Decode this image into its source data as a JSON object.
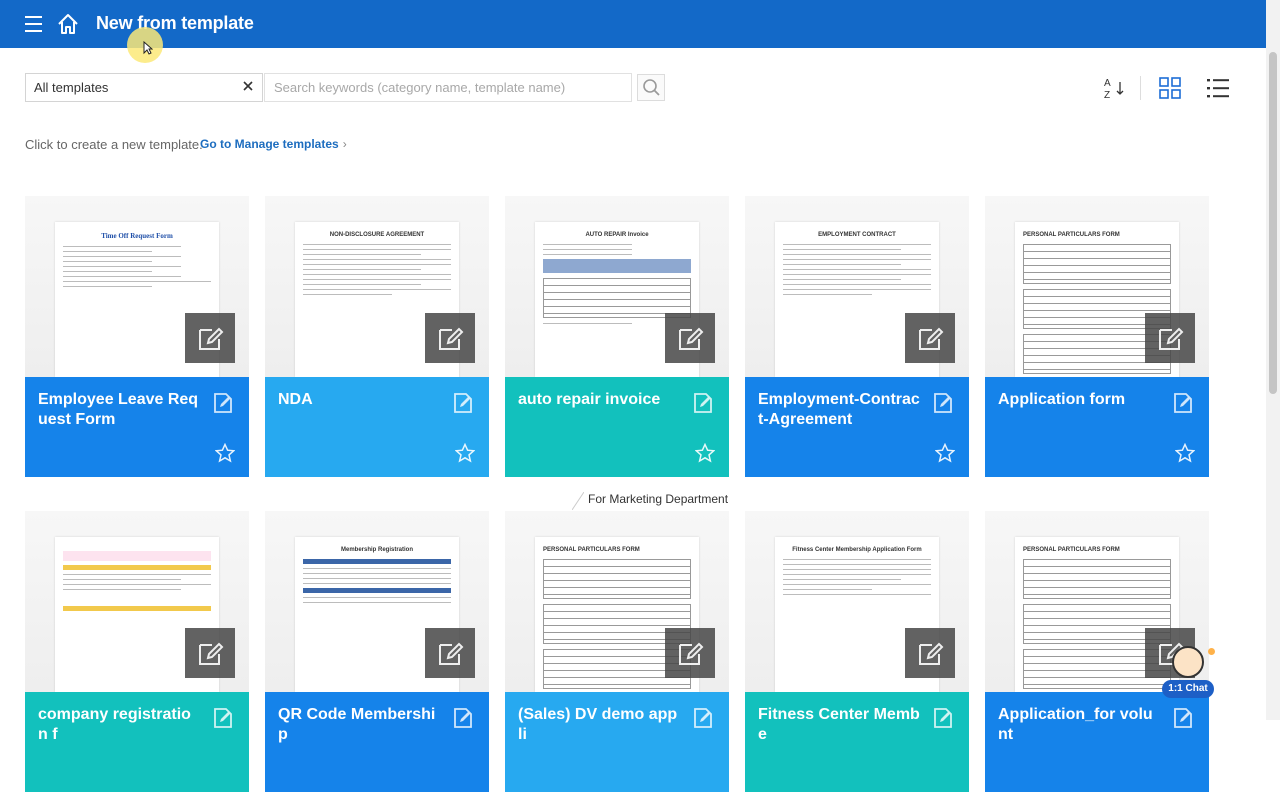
{
  "header": {
    "title": "New from template"
  },
  "toolbar": {
    "filter_value": "All templates",
    "search_placeholder": "Search keywords (category name, template name)"
  },
  "hint": {
    "text": "Click to create a new template.",
    "link": "Go to Manage templates"
  },
  "tag_label": "For Marketing Department",
  "chat": {
    "label": "1:1 Chat"
  },
  "colors": {
    "header": "#1369c8",
    "card_blue": "#1583ea",
    "card_light_blue": "#27a9f0",
    "card_teal": "#12c1bd"
  },
  "cards": [
    {
      "title": "Employee Leave Request Form",
      "doc_title": "Time Off Request Form"
    },
    {
      "title": "NDA",
      "doc_title": "NON-DISCLOSURE AGREEMENT"
    },
    {
      "title": "auto repair invoice",
      "doc_title": "AUTO REPAIR Invoice"
    },
    {
      "title": "Employment-Contract-Agreement",
      "doc_title": "EMPLOYMENT CONTRACT"
    },
    {
      "title": "Application form",
      "doc_title": "PERSONAL PARTICULARS FORM"
    },
    {
      "title": "company registration f",
      "doc_title": ""
    },
    {
      "title": "QR Code Membership",
      "doc_title": "Membership Registration"
    },
    {
      "title": "(Sales) DV demo appli",
      "doc_title": "PERSONAL PARTICULARS FORM"
    },
    {
      "title": "Fitness Center Membe",
      "doc_title": "Fitness Center Membership Application Form"
    },
    {
      "title": "Application_for volunt",
      "doc_title": "PERSONAL PARTICULARS FORM"
    }
  ]
}
